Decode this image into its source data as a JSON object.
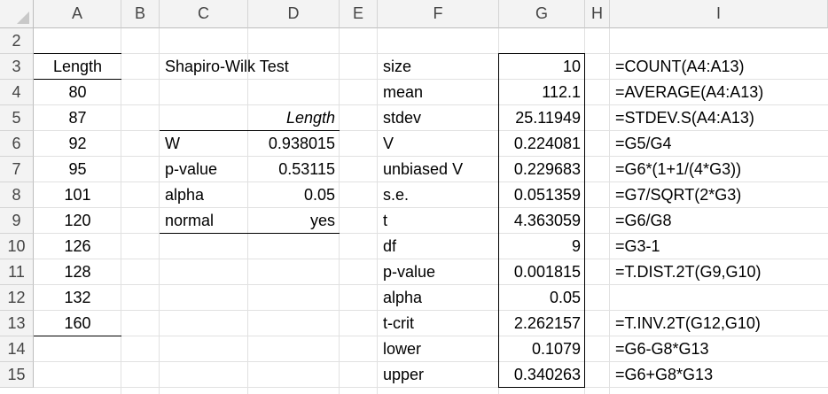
{
  "columns": [
    "A",
    "B",
    "C",
    "D",
    "E",
    "F",
    "G",
    "H",
    "I"
  ],
  "rows": [
    "2",
    "3",
    "4",
    "5",
    "6",
    "7",
    "8",
    "9",
    "10",
    "11",
    "12",
    "13",
    "14",
    "15"
  ],
  "colA": {
    "header": "Length",
    "values": [
      "80",
      "87",
      "92",
      "95",
      "101",
      "120",
      "126",
      "128",
      "132",
      "160"
    ]
  },
  "shapiro": {
    "title": "Shapiro-Wilk Test",
    "col_label": "Length",
    "rows": [
      {
        "label": "W",
        "value": "0.938015"
      },
      {
        "label": "p-value",
        "value": "0.53115"
      },
      {
        "label": "alpha",
        "value": "0.05"
      },
      {
        "label": "normal",
        "value": "yes"
      }
    ]
  },
  "stats": [
    {
      "label": "size",
      "value": "10",
      "formula": "=COUNT(A4:A13)"
    },
    {
      "label": "mean",
      "value": "112.1",
      "formula": "=AVERAGE(A4:A13)"
    },
    {
      "label": "stdev",
      "value": "25.11949",
      "formula": "=STDEV.S(A4:A13)"
    },
    {
      "label": "V",
      "value": "0.224081",
      "formula": "=G5/G4"
    },
    {
      "label": "unbiased V",
      "value": "0.229683",
      "formula": "=G6*(1+1/(4*G3))"
    },
    {
      "label": "s.e.",
      "value": "0.051359",
      "formula": "=G7/SQRT(2*G3)"
    },
    {
      "label": "t",
      "value": "4.363059",
      "formula": "=G6/G8"
    },
    {
      "label": "df",
      "value": "9",
      "formula": "=G3-1"
    },
    {
      "label": "p-value",
      "value": "0.001815",
      "formula": "=T.DIST.2T(G9,G10)"
    },
    {
      "label": "alpha",
      "value": "0.05",
      "formula": ""
    },
    {
      "label": "t-crit",
      "value": "2.262157",
      "formula": "=T.INV.2T(G12,G10)"
    },
    {
      "label": "lower",
      "value": "0.1079",
      "formula": "=G6-G8*G13"
    },
    {
      "label": "upper",
      "value": "0.340263",
      "formula": "=G6+G8*G13"
    }
  ]
}
